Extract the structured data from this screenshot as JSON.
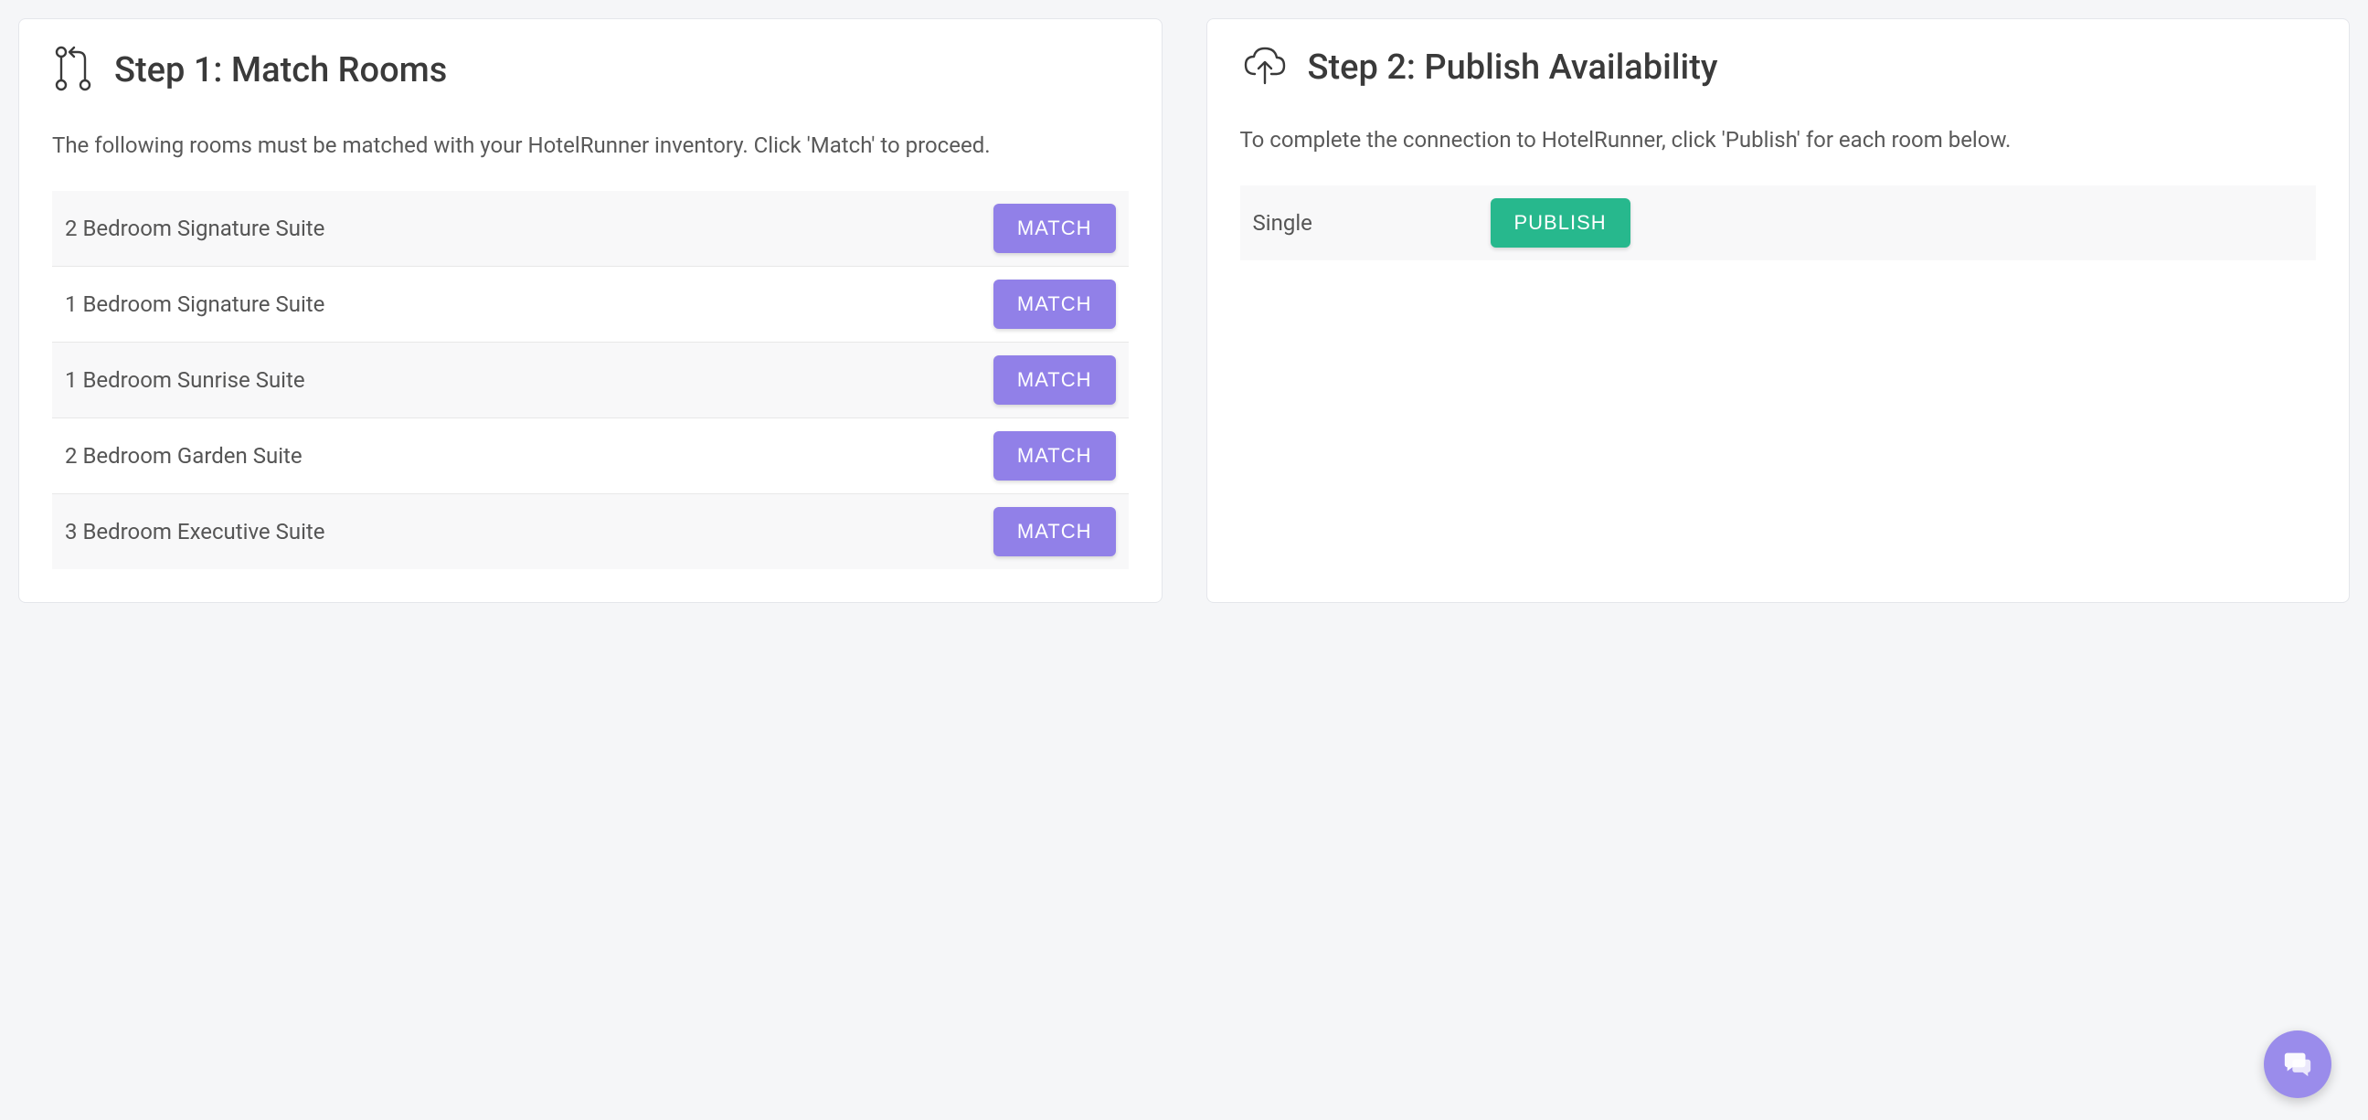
{
  "step1": {
    "title": "Step 1: Match Rooms",
    "description": "The following rooms must be matched with your HotelRunner inventory. Click 'Match' to proceed.",
    "button_label": "MATCH",
    "rooms": [
      {
        "name": "2 Bedroom Signature Suite"
      },
      {
        "name": "1 Bedroom Signature Suite"
      },
      {
        "name": "1 Bedroom Sunrise Suite"
      },
      {
        "name": "2 Bedroom Garden Suite"
      },
      {
        "name": "3 Bedroom Executive Suite"
      }
    ]
  },
  "step2": {
    "title": "Step 2: Publish Availability",
    "description": "To complete the connection to HotelRunner, click 'Publish' for each room below.",
    "button_label": "PUBLISH",
    "rooms": [
      {
        "name": "Single"
      }
    ]
  },
  "colors": {
    "match_button": "#9180e8",
    "publish_button": "#27b88d",
    "fab": "#9a8ceb"
  }
}
